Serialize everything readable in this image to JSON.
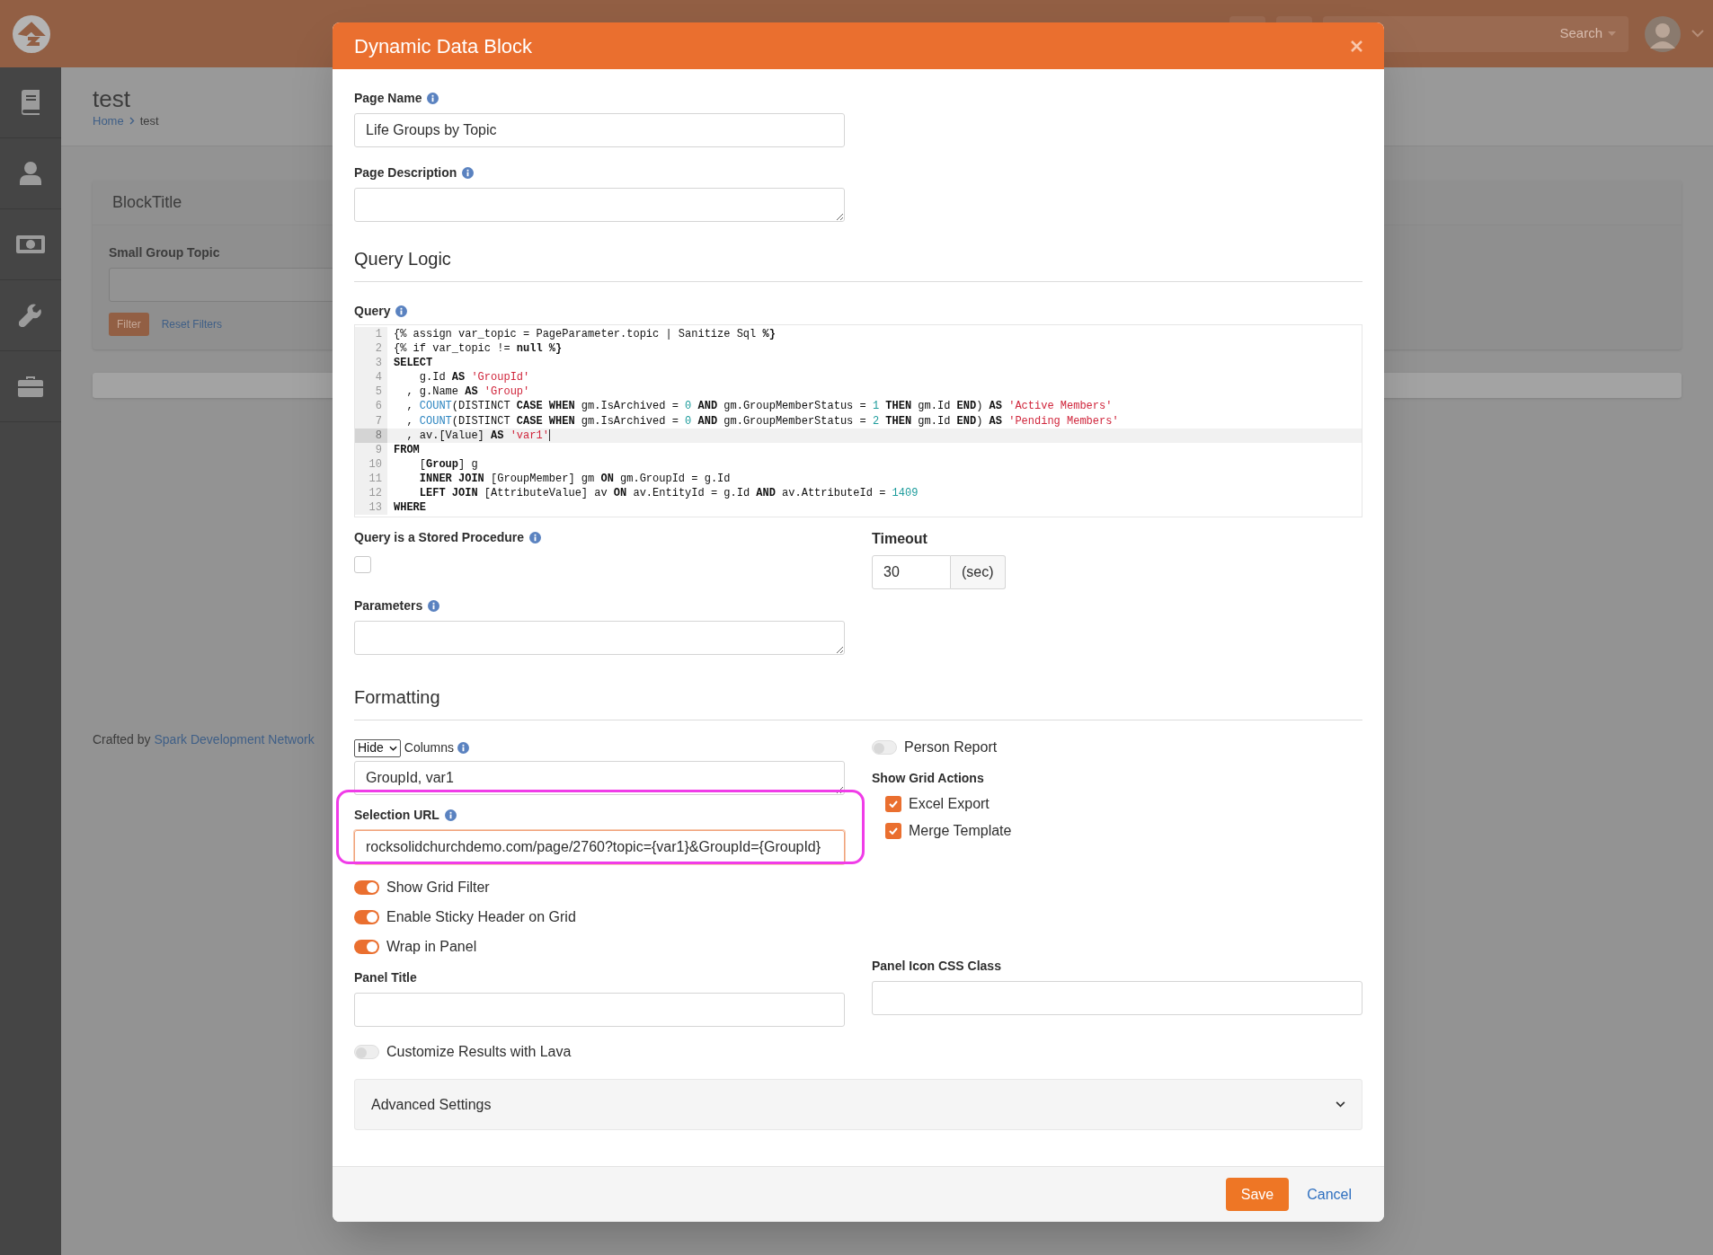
{
  "app_header": {
    "search_label": "Search"
  },
  "page": {
    "title": "test",
    "breadcrumb": [
      "Home",
      "test"
    ],
    "block": {
      "title": "BlockTitle",
      "filter_label": "Small Group Topic",
      "filter_button": "Filter",
      "reset_link": "Reset Filters"
    },
    "footer": {
      "prefix": "Crafted by",
      "link": "Spark Development Network"
    }
  },
  "modal": {
    "title": "Dynamic Data Block",
    "page_name": {
      "label": "Page Name",
      "value": "Life Groups by Topic"
    },
    "page_description": {
      "label": "Page Description"
    },
    "query_logic": {
      "heading": "Query Logic",
      "query_label": "Query",
      "code_lines": [
        {
          "number": "1",
          "active": false,
          "tokens": [
            {
              "text": "{% assign var_topic = PageParameter.topic | Sanitize Sql ",
              "kind": "plain"
            },
            {
              "text": "%}",
              "kind": "keyword"
            }
          ]
        },
        {
          "number": "2",
          "active": false,
          "tokens": [
            {
              "text": "{% if var_topic != ",
              "kind": "plain"
            },
            {
              "text": "null %}",
              "kind": "keyword"
            }
          ]
        },
        {
          "number": "3",
          "active": false,
          "tokens": [
            {
              "text": "SELECT",
              "kind": "keyword"
            }
          ]
        },
        {
          "number": "4",
          "active": false,
          "tokens": [
            {
              "text": "    g.Id ",
              "kind": "plain"
            },
            {
              "text": "AS",
              "kind": "keyword"
            },
            {
              "text": " 'GroupId'",
              "kind": "string"
            }
          ]
        },
        {
          "number": "5",
          "active": false,
          "tokens": [
            {
              "text": "  , g.Name ",
              "kind": "plain"
            },
            {
              "text": "AS",
              "kind": "keyword"
            },
            {
              "text": " 'Group'",
              "kind": "string"
            }
          ]
        },
        {
          "number": "6",
          "active": false,
          "tokens": [
            {
              "text": "  , ",
              "kind": "plain"
            },
            {
              "text": "COUNT",
              "kind": "function"
            },
            {
              "text": "(DISTINCT ",
              "kind": "plain"
            },
            {
              "text": "CASE WHEN",
              "kind": "keyword"
            },
            {
              "text": " gm.IsArchived = ",
              "kind": "plain"
            },
            {
              "text": "0",
              "kind": "number"
            },
            {
              "text": " AND",
              "kind": "keyword"
            },
            {
              "text": " gm.GroupMemberStatus = ",
              "kind": "plain"
            },
            {
              "text": "1",
              "kind": "number"
            },
            {
              "text": " THEN",
              "kind": "keyword"
            },
            {
              "text": " gm.Id ",
              "kind": "plain"
            },
            {
              "text": "END",
              "kind": "keyword"
            },
            {
              "text": ") ",
              "kind": "plain"
            },
            {
              "text": "AS",
              "kind": "keyword"
            },
            {
              "text": " 'Active Members'",
              "kind": "string"
            }
          ]
        },
        {
          "number": "7",
          "active": false,
          "tokens": [
            {
              "text": "  , ",
              "kind": "plain"
            },
            {
              "text": "COUNT",
              "kind": "function"
            },
            {
              "text": "(DISTINCT ",
              "kind": "plain"
            },
            {
              "text": "CASE WHEN",
              "kind": "keyword"
            },
            {
              "text": " gm.IsArchived = ",
              "kind": "plain"
            },
            {
              "text": "0",
              "kind": "number"
            },
            {
              "text": " AND",
              "kind": "keyword"
            },
            {
              "text": " gm.GroupMemberStatus = ",
              "kind": "plain"
            },
            {
              "text": "2",
              "kind": "number"
            },
            {
              "text": " THEN",
              "kind": "keyword"
            },
            {
              "text": " gm.Id ",
              "kind": "plain"
            },
            {
              "text": "END",
              "kind": "keyword"
            },
            {
              "text": ") ",
              "kind": "plain"
            },
            {
              "text": "AS",
              "kind": "keyword"
            },
            {
              "text": " 'Pending Members'",
              "kind": "string"
            }
          ]
        },
        {
          "number": "8",
          "active": true,
          "tokens": [
            {
              "text": "  , av.[Value] ",
              "kind": "plain"
            },
            {
              "text": "AS",
              "kind": "keyword"
            },
            {
              "text": " 'var1'",
              "kind": "string"
            }
          ]
        },
        {
          "number": "9",
          "active": false,
          "tokens": [
            {
              "text": "FROM",
              "kind": "keyword"
            }
          ]
        },
        {
          "number": "10",
          "active": false,
          "tokens": [
            {
              "text": "    [",
              "kind": "plain"
            },
            {
              "text": "Group",
              "kind": "keyword"
            },
            {
              "text": "] g",
              "kind": "plain"
            }
          ]
        },
        {
          "number": "11",
          "active": false,
          "tokens": [
            {
              "text": "    INNER JOIN",
              "kind": "keyword"
            },
            {
              "text": " [GroupMember] gm ",
              "kind": "plain"
            },
            {
              "text": "ON",
              "kind": "keyword"
            },
            {
              "text": " gm.GroupId = g.Id",
              "kind": "plain"
            }
          ]
        },
        {
          "number": "12",
          "active": false,
          "tokens": [
            {
              "text": "    LEFT JOIN",
              "kind": "keyword"
            },
            {
              "text": " [AttributeValue] av ",
              "kind": "plain"
            },
            {
              "text": "ON",
              "kind": "keyword"
            },
            {
              "text": " av.EntityId = g.Id ",
              "kind": "plain"
            },
            {
              "text": "AND",
              "kind": "keyword"
            },
            {
              "text": " av.AttributeId = ",
              "kind": "plain"
            },
            {
              "text": "1409",
              "kind": "number"
            }
          ]
        },
        {
          "number": "13",
          "active": false,
          "tokens": [
            {
              "text": "WHERE",
              "kind": "keyword"
            }
          ]
        }
      ],
      "stored_procedure": {
        "label": "Query is a Stored Procedure",
        "checked": false
      },
      "timeout": {
        "label": "Timeout",
        "value": "30",
        "unit": "(sec)"
      },
      "parameters": {
        "label": "Parameters"
      }
    },
    "formatting": {
      "heading": "Formatting",
      "columns": {
        "mode": "Hide",
        "label": "Columns",
        "value": "GroupId, var1"
      },
      "selection_url": {
        "label": "Selection URL",
        "value": "rocksolidchurchdemo.com/page/2760?topic={var1}&GroupId={GroupId}",
        "highlighted": true
      },
      "toggles": [
        {
          "label": "Show Grid Filter",
          "on": true
        },
        {
          "label": "Enable Sticky Header on Grid",
          "on": true
        },
        {
          "label": "Wrap in Panel",
          "on": true
        }
      ],
      "person_report": {
        "label": "Person Report",
        "on": false
      },
      "grid_actions": {
        "label": "Show Grid Actions",
        "options": [
          {
            "label": "Excel Export",
            "checked": true
          },
          {
            "label": "Merge Template",
            "checked": true
          }
        ]
      },
      "panel_title": {
        "label": "Panel Title"
      },
      "panel_icon": {
        "label": "Panel Icon CSS Class"
      },
      "customize_lava": {
        "label": "Customize Results with Lava",
        "on": false
      }
    },
    "advanced": {
      "label": "Advanced Settings",
      "expanded": false
    },
    "buttons": [
      {
        "label": "Save",
        "kind": "primary"
      },
      {
        "label": "Cancel",
        "kind": "link"
      }
    ]
  }
}
